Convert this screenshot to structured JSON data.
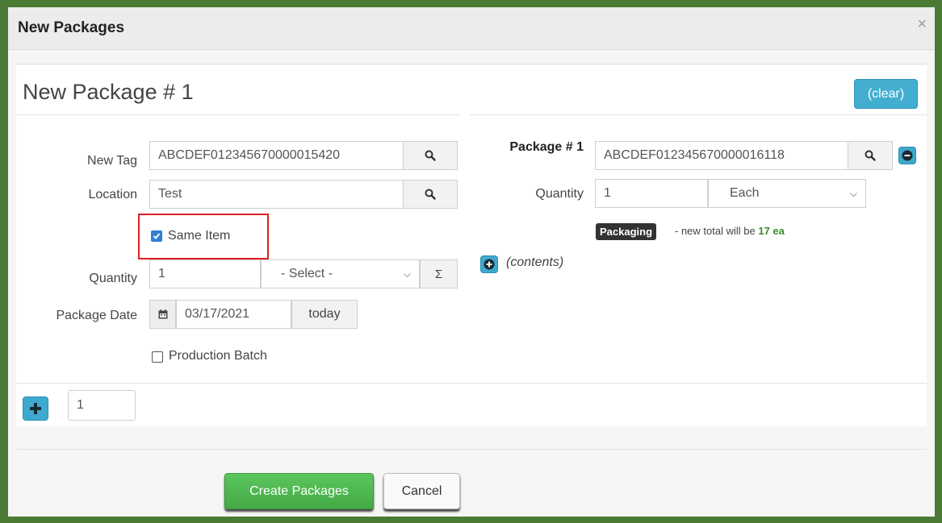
{
  "modal": {
    "title": "New Packages",
    "close_glyph": "×"
  },
  "package": {
    "title": "New Package # 1",
    "clear_label": "(clear)"
  },
  "form": {
    "new_tag": {
      "label": "New Tag",
      "value": "ABCDEF012345670000015420"
    },
    "location": {
      "label": "Location",
      "value": "Test"
    },
    "same_item": {
      "label": "Same Item",
      "checked": true
    },
    "quantity": {
      "label": "Quantity",
      "value": "1",
      "unit": "- Select -",
      "sum_glyph": "Σ"
    },
    "package_date": {
      "label": "Package Date",
      "value": "03/17/2021",
      "today_label": "today"
    },
    "production_batch": {
      "label": "Production Batch",
      "checked": false
    }
  },
  "source_package": {
    "label": "Package # 1",
    "tag": "ABCDEF012345670000016118",
    "quantity_label": "Quantity",
    "quantity": "1",
    "unit": "Each",
    "badge": "Packaging",
    "note_prefix": "- new total will be",
    "note_total": "17 ea",
    "contents_label": "(contents)"
  },
  "footer": {
    "count": "1",
    "create_label": "Create Packages",
    "cancel_label": "Cancel"
  },
  "icons": {
    "search": "search-icon",
    "calendar": "calendar-icon",
    "remove": "minus-circle-icon",
    "add": "plus-circle-icon",
    "plus": "plus-icon"
  },
  "colors": {
    "accent": "#43aed0",
    "success": "#4cb54e",
    "highlight": "#e02020",
    "note_green": "#3c8a2c"
  }
}
